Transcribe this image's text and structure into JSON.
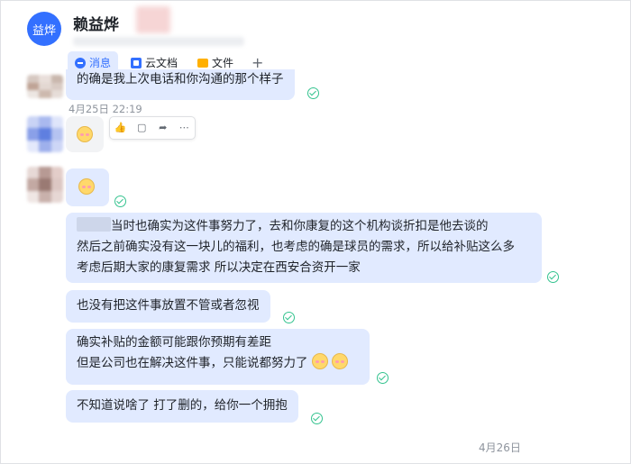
{
  "header": {
    "avatar_text": "益烨",
    "title": "赖益烨",
    "tabs": [
      {
        "label": "消息",
        "icon": "chat-icon",
        "active": true
      },
      {
        "label": "云文档",
        "icon": "doc-icon",
        "active": false
      },
      {
        "label": "文件",
        "icon": "folder-icon",
        "active": false
      }
    ],
    "add_tab": "+"
  },
  "messages": {
    "m0": {
      "text": "的确是我上次电话和你沟通的那个样子"
    },
    "time1": "4月25日 22:19",
    "m2": {
      "line1": "当时也确实为这件事努力了，去和你康复的这个机构谈折扣是他去谈的",
      "line2": "然后之前确实没有这一块儿的福利，也考虑的确是球员的需求，所以给补贴这么多",
      "line3": "考虑后期大家的康复需求 所以决定在西安合资开一家"
    },
    "m3": {
      "text": "也没有把这件事放置不管或者忽视"
    },
    "m4": {
      "line1": "确实补贴的金额可能跟你预期有差距",
      "line2": "但是公司也在解决这件事，只能说都努力了"
    },
    "m5": {
      "text": "不知道说啥了 打了删的，给你一个拥抱"
    },
    "date_footer": "4月26日"
  },
  "toolbar": {
    "buttons": [
      "thumbs-up-icon",
      "comment-icon",
      "forward-icon",
      "more-icon"
    ]
  },
  "colors": {
    "accent": "#3370ff",
    "bubble": "#e1eaff",
    "read": "#34c38f"
  }
}
